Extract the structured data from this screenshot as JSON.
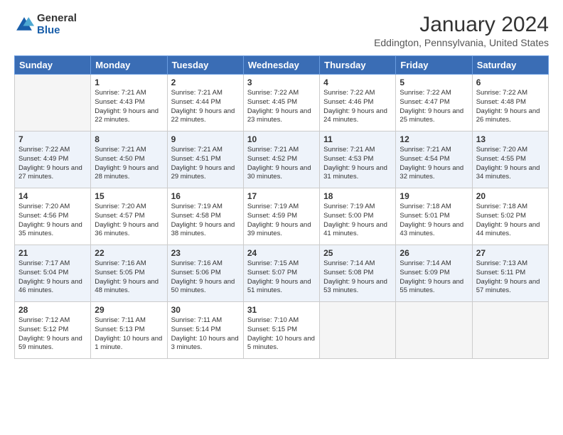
{
  "logo": {
    "general": "General",
    "blue": "Blue"
  },
  "title": "January 2024",
  "subtitle": "Eddington, Pennsylvania, United States",
  "days_of_week": [
    "Sunday",
    "Monday",
    "Tuesday",
    "Wednesday",
    "Thursday",
    "Friday",
    "Saturday"
  ],
  "weeks": [
    [
      {
        "day": "",
        "empty": true
      },
      {
        "day": "1",
        "sunrise": "7:21 AM",
        "sunset": "4:43 PM",
        "daylight": "9 hours and 22 minutes."
      },
      {
        "day": "2",
        "sunrise": "7:21 AM",
        "sunset": "4:44 PM",
        "daylight": "9 hours and 22 minutes."
      },
      {
        "day": "3",
        "sunrise": "7:22 AM",
        "sunset": "4:45 PM",
        "daylight": "9 hours and 23 minutes."
      },
      {
        "day": "4",
        "sunrise": "7:22 AM",
        "sunset": "4:46 PM",
        "daylight": "9 hours and 24 minutes."
      },
      {
        "day": "5",
        "sunrise": "7:22 AM",
        "sunset": "4:47 PM",
        "daylight": "9 hours and 25 minutes."
      },
      {
        "day": "6",
        "sunrise": "7:22 AM",
        "sunset": "4:48 PM",
        "daylight": "9 hours and 26 minutes."
      }
    ],
    [
      {
        "day": "7",
        "sunrise": "7:22 AM",
        "sunset": "4:49 PM",
        "daylight": "9 hours and 27 minutes."
      },
      {
        "day": "8",
        "sunrise": "7:21 AM",
        "sunset": "4:50 PM",
        "daylight": "9 hours and 28 minutes."
      },
      {
        "day": "9",
        "sunrise": "7:21 AM",
        "sunset": "4:51 PM",
        "daylight": "9 hours and 29 minutes."
      },
      {
        "day": "10",
        "sunrise": "7:21 AM",
        "sunset": "4:52 PM",
        "daylight": "9 hours and 30 minutes."
      },
      {
        "day": "11",
        "sunrise": "7:21 AM",
        "sunset": "4:53 PM",
        "daylight": "9 hours and 31 minutes."
      },
      {
        "day": "12",
        "sunrise": "7:21 AM",
        "sunset": "4:54 PM",
        "daylight": "9 hours and 32 minutes."
      },
      {
        "day": "13",
        "sunrise": "7:20 AM",
        "sunset": "4:55 PM",
        "daylight": "9 hours and 34 minutes."
      }
    ],
    [
      {
        "day": "14",
        "sunrise": "7:20 AM",
        "sunset": "4:56 PM",
        "daylight": "9 hours and 35 minutes."
      },
      {
        "day": "15",
        "sunrise": "7:20 AM",
        "sunset": "4:57 PM",
        "daylight": "9 hours and 36 minutes."
      },
      {
        "day": "16",
        "sunrise": "7:19 AM",
        "sunset": "4:58 PM",
        "daylight": "9 hours and 38 minutes."
      },
      {
        "day": "17",
        "sunrise": "7:19 AM",
        "sunset": "4:59 PM",
        "daylight": "9 hours and 39 minutes."
      },
      {
        "day": "18",
        "sunrise": "7:19 AM",
        "sunset": "5:00 PM",
        "daylight": "9 hours and 41 minutes."
      },
      {
        "day": "19",
        "sunrise": "7:18 AM",
        "sunset": "5:01 PM",
        "daylight": "9 hours and 43 minutes."
      },
      {
        "day": "20",
        "sunrise": "7:18 AM",
        "sunset": "5:02 PM",
        "daylight": "9 hours and 44 minutes."
      }
    ],
    [
      {
        "day": "21",
        "sunrise": "7:17 AM",
        "sunset": "5:04 PM",
        "daylight": "9 hours and 46 minutes."
      },
      {
        "day": "22",
        "sunrise": "7:16 AM",
        "sunset": "5:05 PM",
        "daylight": "9 hours and 48 minutes."
      },
      {
        "day": "23",
        "sunrise": "7:16 AM",
        "sunset": "5:06 PM",
        "daylight": "9 hours and 50 minutes."
      },
      {
        "day": "24",
        "sunrise": "7:15 AM",
        "sunset": "5:07 PM",
        "daylight": "9 hours and 51 minutes."
      },
      {
        "day": "25",
        "sunrise": "7:14 AM",
        "sunset": "5:08 PM",
        "daylight": "9 hours and 53 minutes."
      },
      {
        "day": "26",
        "sunrise": "7:14 AM",
        "sunset": "5:09 PM",
        "daylight": "9 hours and 55 minutes."
      },
      {
        "day": "27",
        "sunrise": "7:13 AM",
        "sunset": "5:11 PM",
        "daylight": "9 hours and 57 minutes."
      }
    ],
    [
      {
        "day": "28",
        "sunrise": "7:12 AM",
        "sunset": "5:12 PM",
        "daylight": "9 hours and 59 minutes."
      },
      {
        "day": "29",
        "sunrise": "7:11 AM",
        "sunset": "5:13 PM",
        "daylight": "10 hours and 1 minute."
      },
      {
        "day": "30",
        "sunrise": "7:11 AM",
        "sunset": "5:14 PM",
        "daylight": "10 hours and 3 minutes."
      },
      {
        "day": "31",
        "sunrise": "7:10 AM",
        "sunset": "5:15 PM",
        "daylight": "10 hours and 5 minutes."
      },
      {
        "day": "",
        "empty": true
      },
      {
        "day": "",
        "empty": true
      },
      {
        "day": "",
        "empty": true
      }
    ]
  ]
}
